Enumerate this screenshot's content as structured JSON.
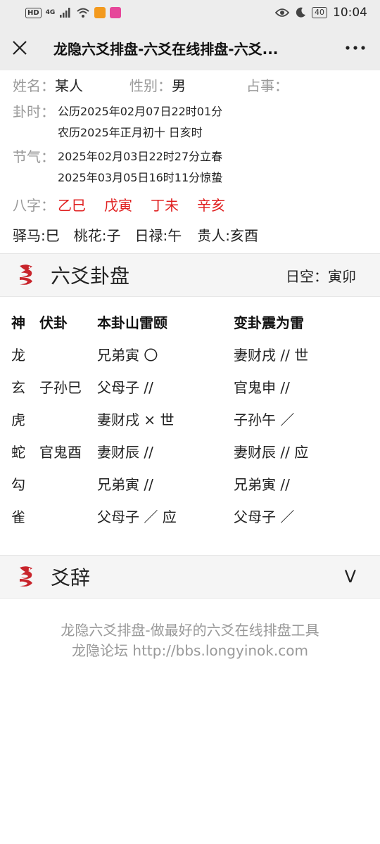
{
  "status_bar": {
    "hd": "HD",
    "net": "4G",
    "battery": "40",
    "time": "10:04"
  },
  "titlebar": {
    "title": "龙隐六爻排盘-六爻在线排盘-六爻..."
  },
  "info": {
    "name_label": "姓名：",
    "name_value": "某人",
    "gender_label": "性别：",
    "gender_value": "男",
    "matter_label": "占事：",
    "time_label": "卦时：",
    "time_solar": "公历2025年02月07日22时01分",
    "time_lunar": "农历2025年正月初十 日亥时",
    "jieqi_label": "节气：",
    "jieqi_1": "2025年02月03日22时27分立春",
    "jieqi_2": "2025年03月05日16时11分惊蛰",
    "bazi_label": "八字：",
    "bazi": [
      "乙巳",
      "戊寅",
      "丁未",
      "辛亥"
    ],
    "shensha": [
      "驿马:巳",
      "桃花:子",
      "日禄:午",
      "贵人:亥酉"
    ]
  },
  "section_gua": {
    "title": "六爻卦盘",
    "rikong": "日空：寅卯"
  },
  "gua_table": {
    "headers": [
      "神",
      "伏卦",
      "本卦山雷颐",
      "变卦震为雷"
    ],
    "rows": [
      [
        "龙",
        "",
        "兄弟寅 〇",
        "妻财戌 // 世"
      ],
      [
        "玄",
        "子孙巳",
        "父母子 //",
        "官鬼申 //"
      ],
      [
        "虎",
        "",
        "妻财戌 × 世",
        "子孙午 ／"
      ],
      [
        "蛇",
        "官鬼酉",
        "妻财辰 //",
        "妻财辰 // 应"
      ],
      [
        "勾",
        "",
        "兄弟寅 //",
        "兄弟寅 //"
      ],
      [
        "雀",
        "",
        "父母子 ／ 应",
        "父母子 ／"
      ]
    ]
  },
  "section_yaoci": {
    "title": "爻辞",
    "toggle": "V"
  },
  "footer": {
    "line1": "龙隐六爻排盘-做最好的六爻在线排盘工具",
    "line2": "龙隐论坛 http://bbs.longyinok.com"
  },
  "colors": {
    "accent_red": "#e02020",
    "label_gray": "#999999",
    "bar_bg": "#ededed"
  },
  "icons": {
    "close": "close-icon",
    "more": "more-icon",
    "section": "dragon-logo-icon"
  }
}
